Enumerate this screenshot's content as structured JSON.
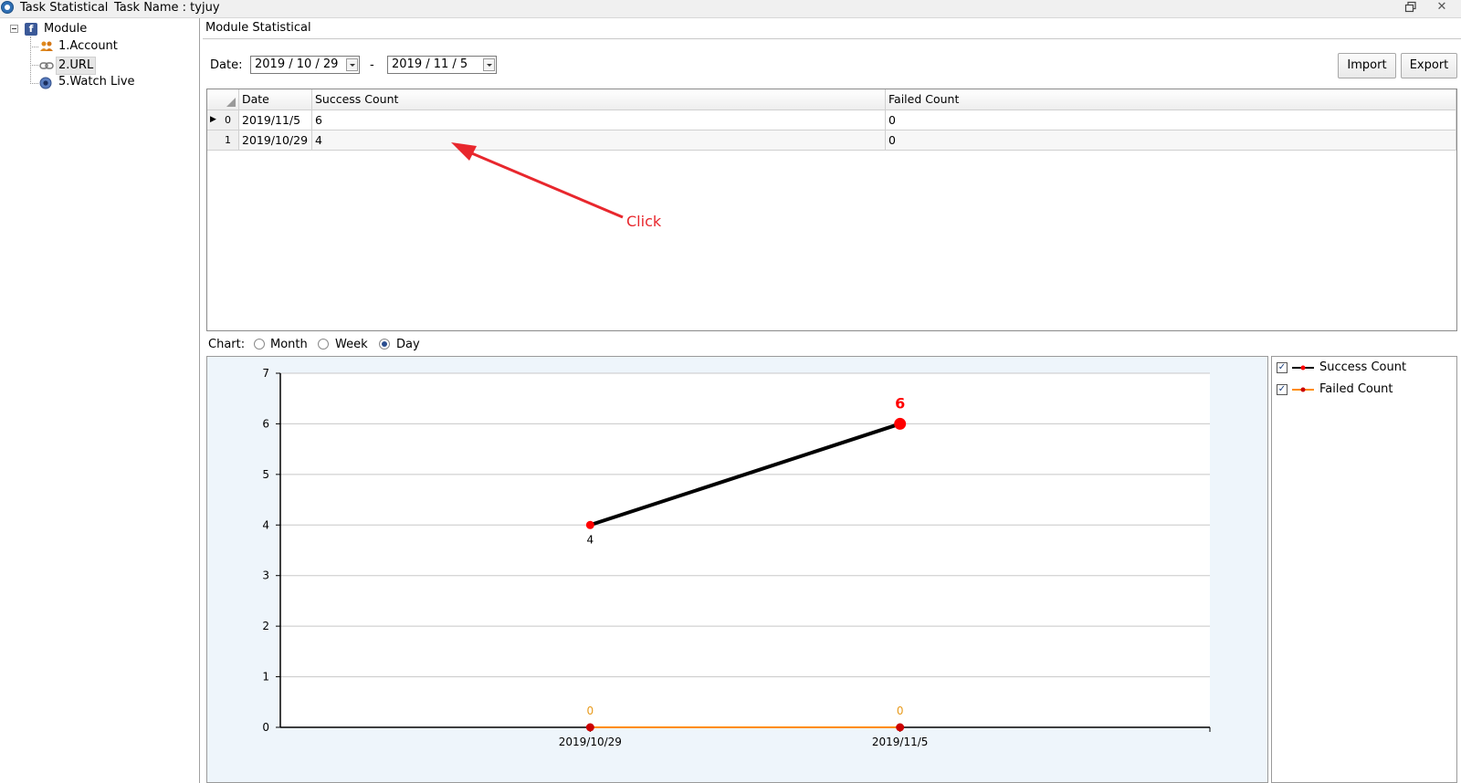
{
  "window": {
    "title": "Task Statistical",
    "task_name": "Task Name : tyjuy",
    "restore_icon": "restore-icon",
    "close_icon": "close-icon"
  },
  "tree": {
    "root": "Module",
    "items": [
      {
        "label": "1.Account",
        "icon": "users-icon"
      },
      {
        "label": "2.URL",
        "icon": "link-icon",
        "selected": true
      },
      {
        "label": "5.Watch Live",
        "icon": "eye-icon"
      }
    ]
  },
  "panel": {
    "title": "Module Statistical",
    "date_label": "Date:",
    "date_from": "2019 / 10 / 29",
    "date_sep": "-",
    "date_to": "2019 / 11 / 5",
    "import_label": "Import",
    "export_label": "Export"
  },
  "grid": {
    "columns": [
      "Date",
      "Success Count",
      "Failed Count"
    ],
    "rows": [
      {
        "index": "0",
        "date": "2019/11/5",
        "success": "6",
        "failed": "0"
      },
      {
        "index": "1",
        "date": "2019/10/29",
        "success": "4",
        "failed": "0"
      }
    ]
  },
  "annotation": {
    "text": "Click",
    "color": "#e8272d"
  },
  "chart_options": {
    "label": "Chart:",
    "options": [
      "Month",
      "Week",
      "Day"
    ],
    "selected": "Day"
  },
  "legend": [
    {
      "name": "Success Count",
      "checked": true,
      "color": "#000000"
    },
    {
      "name": "Failed Count",
      "checked": true,
      "color": "#ff8c00"
    }
  ],
  "chart_data": {
    "type": "line",
    "categories": [
      "2019/10/29",
      "2019/11/5"
    ],
    "series": [
      {
        "name": "Success Count",
        "values": [
          4,
          6
        ],
        "color": "#000000",
        "marker_color": "#ff0000"
      },
      {
        "name": "Failed Count",
        "values": [
          0,
          0
        ],
        "color": "#ff8c00",
        "marker_color": "#cc0000"
      }
    ],
    "ylim": [
      0,
      7
    ],
    "yticks": [
      0,
      1,
      2,
      3,
      4,
      5,
      6,
      7
    ],
    "grid": true,
    "data_labels": true,
    "legend_position": "right"
  }
}
